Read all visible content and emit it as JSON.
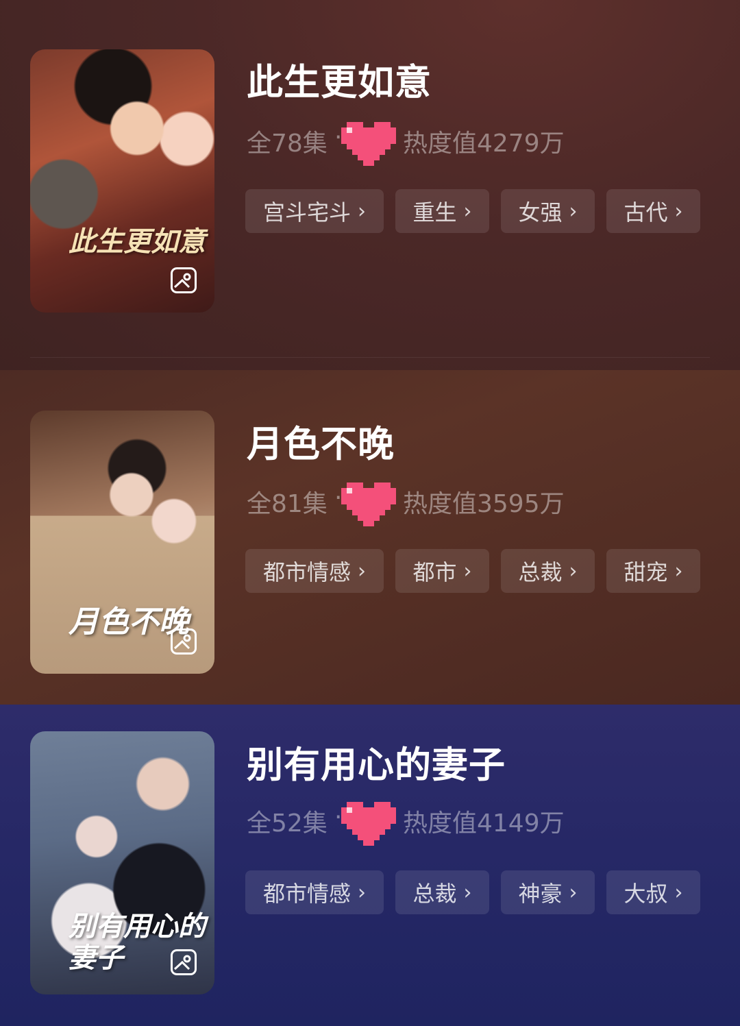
{
  "dramas": [
    {
      "title": "此生更如意",
      "episodes": "全78集",
      "separator": "·",
      "heat": "热度值4279万",
      "poster_title": "此生更如意",
      "tags": [
        {
          "label": "宫斗宅斗",
          "chevron": "›"
        },
        {
          "label": "重生",
          "chevron": "›"
        },
        {
          "label": "女强",
          "chevron": "›"
        },
        {
          "label": "古代",
          "chevron": "›"
        }
      ]
    },
    {
      "title": "月色不晚",
      "episodes": "全81集",
      "separator": "·",
      "heat": "热度值3595万",
      "poster_title": "月色不晚",
      "tags": [
        {
          "label": "都市情感",
          "chevron": "›"
        },
        {
          "label": "都市",
          "chevron": "›"
        },
        {
          "label": "总裁",
          "chevron": "›"
        },
        {
          "label": "甜宠",
          "chevron": "›"
        }
      ]
    },
    {
      "title": "别有用心的妻子",
      "episodes": "全52集",
      "separator": "·",
      "heat": "热度值4149万",
      "poster_title": "别有用心的妻子",
      "tags": [
        {
          "label": "都市情感",
          "chevron": "›"
        },
        {
          "label": "总裁",
          "chevron": "›"
        },
        {
          "label": "神豪",
          "chevron": "›"
        },
        {
          "label": "大叔",
          "chevron": "›"
        }
      ]
    }
  ],
  "icons": {
    "heart": "pixel-heart-icon",
    "poster_badge": "image-gallery-icon",
    "tag_chevron": "chevron-right-icon"
  },
  "colors": {
    "heart": "#f4507a",
    "title": "#ffffff",
    "meta": "#9c8a88"
  }
}
